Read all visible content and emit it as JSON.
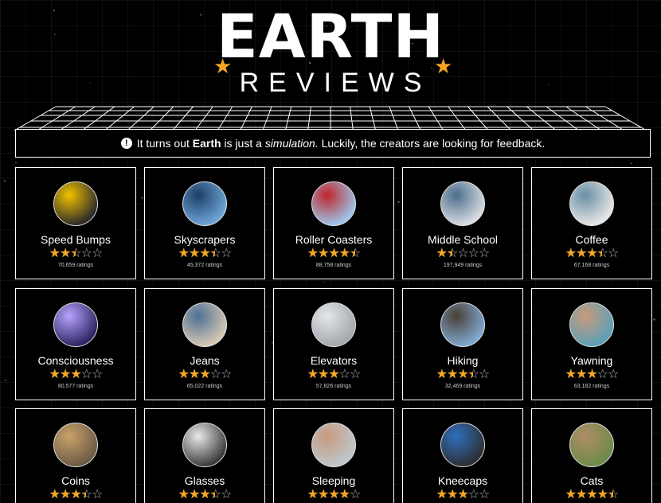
{
  "header": {
    "title": "EARTH",
    "subtitle": "REVIEWS"
  },
  "notice": {
    "prefix": "It turns out",
    "earth": "Earth",
    "middle": "is just a",
    "simulation": "simulation.",
    "suffix": "Luckily, the creators are looking for feedback."
  },
  "colors": {
    "accent": "#f5a623",
    "background": "#000000",
    "border": "#ffffff"
  },
  "items": [
    {
      "name": "Speed Bumps",
      "ratings": "70,659 ratings",
      "rating": 2.5,
      "thumb": [
        "#2a2a2a",
        "#f2c200"
      ]
    },
    {
      "name": "Skyscrapers",
      "ratings": "45,372 ratings",
      "rating": 3.5,
      "thumb": [
        "#6fa6d8",
        "#1d3f66"
      ]
    },
    {
      "name": "Roller Coasters",
      "ratings": "88,758 ratings",
      "rating": 4.5,
      "thumb": [
        "#9cc7ee",
        "#c0262b"
      ]
    },
    {
      "name": "Middle School",
      "ratings": "197,949 ratings",
      "rating": 1.5,
      "thumb": [
        "#d9dde2",
        "#4b6e8c"
      ]
    },
    {
      "name": "Coffee",
      "ratings": "67,168 ratings",
      "rating": 3.5,
      "thumb": [
        "#e7e7e7",
        "#6a8ea5"
      ]
    },
    {
      "name": "Consciousness",
      "ratings": "80,577 ratings",
      "rating": 3.0,
      "thumb": [
        "#2b2560",
        "#b9a2ff"
      ]
    },
    {
      "name": "Jeans",
      "ratings": "65,022 ratings",
      "rating": 3.0,
      "thumb": [
        "#d7c8b4",
        "#4d6f95"
      ]
    },
    {
      "name": "Elevators",
      "ratings": "57,826 ratings",
      "rating": 3.0,
      "thumb": [
        "#a3a8ad",
        "#e4e6e8"
      ]
    },
    {
      "name": "Hiking",
      "ratings": "32,469 ratings",
      "rating": 3.5,
      "thumb": [
        "#7fa9d1",
        "#4a4036"
      ]
    },
    {
      "name": "Yawning",
      "ratings": "63,182 ratings",
      "rating": 3.0,
      "thumb": [
        "#5ba0b8",
        "#c99a7a"
      ]
    },
    {
      "name": "Coins",
      "ratings": "",
      "rating": 3.5,
      "thumb": [
        "#6b5a44",
        "#c9a36b"
      ]
    },
    {
      "name": "Glasses",
      "ratings": "",
      "rating": 3.5,
      "thumb": [
        "#3a3a3a",
        "#e9e9e9"
      ]
    },
    {
      "name": "Sleeping",
      "ratings": "",
      "rating": 4.0,
      "thumb": [
        "#bfc7cc",
        "#c79a7e"
      ]
    },
    {
      "name": "Kneecaps",
      "ratings": "",
      "rating": 3.0,
      "thumb": [
        "#2d2f33",
        "#2f6fbe"
      ]
    },
    {
      "name": "Cats",
      "ratings": "",
      "rating": 4.5,
      "thumb": [
        "#6c8a4a",
        "#b08d66"
      ]
    }
  ]
}
